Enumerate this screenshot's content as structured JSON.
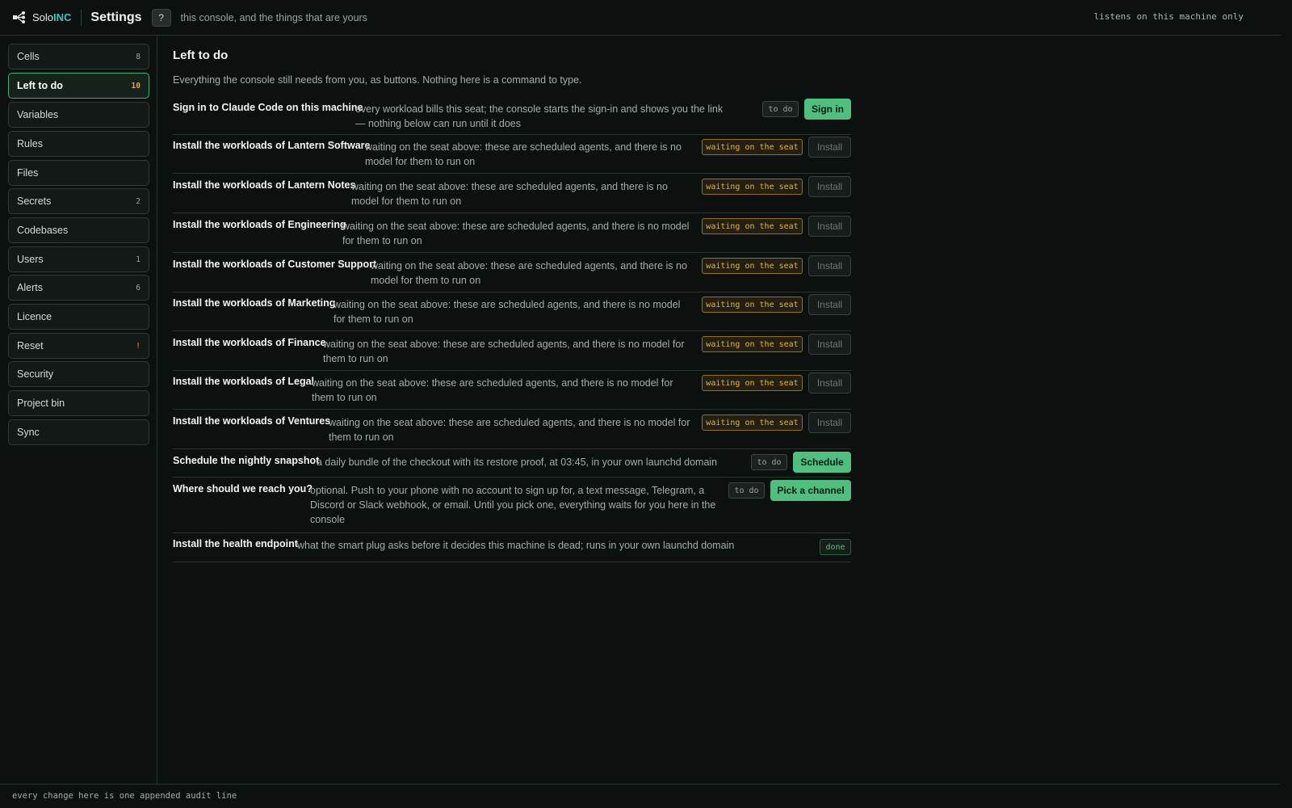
{
  "header": {
    "brand_solo": "Solo",
    "brand_inc": "INC",
    "title": "Settings",
    "help_label": "?",
    "subtitle": "this console, and the things that are yours",
    "status": "listens on this machine only"
  },
  "sidebar": {
    "items": [
      {
        "label": "Cells",
        "count": "8"
      },
      {
        "label": "Left to do",
        "count": "10"
      },
      {
        "label": "Variables",
        "count": ""
      },
      {
        "label": "Rules",
        "count": ""
      },
      {
        "label": "Files",
        "count": ""
      },
      {
        "label": "Secrets",
        "count": "2"
      },
      {
        "label": "Codebases",
        "count": ""
      },
      {
        "label": "Users",
        "count": "1"
      },
      {
        "label": "Alerts",
        "count": "6"
      },
      {
        "label": "Licence",
        "count": ""
      },
      {
        "label": "Reset",
        "count": "!"
      },
      {
        "label": "Security",
        "count": ""
      },
      {
        "label": "Project bin",
        "count": ""
      },
      {
        "label": "Sync",
        "count": ""
      }
    ]
  },
  "main": {
    "title": "Left to do",
    "lead": "Everything the console still needs from you, as buttons. Nothing here is a command to type.",
    "tasks": [
      {
        "title": "Sign in to Claude Code on this machine",
        "desc": "every workload bills this seat; the console starts the sign-in and shows you the link — nothing below can run until it does",
        "status": "to do",
        "button": "Sign in"
      },
      {
        "title": "Install the workloads of Lantern Software",
        "desc": "waiting on the seat above: these are scheduled agents, and there is no model for them to run on",
        "status": "waiting on the seat",
        "button": "Install"
      },
      {
        "title": "Install the workloads of Lantern Notes",
        "desc": "waiting on the seat above: these are scheduled agents, and there is no model for them to run on",
        "status": "waiting on the seat",
        "button": "Install"
      },
      {
        "title": "Install the workloads of Engineering",
        "desc": "waiting on the seat above: these are scheduled agents, and there is no model for them to run on",
        "status": "waiting on the seat",
        "button": "Install"
      },
      {
        "title": "Install the workloads of Customer Support",
        "desc": "waiting on the seat above: these are scheduled agents, and there is no model for them to run on",
        "status": "waiting on the seat",
        "button": "Install"
      },
      {
        "title": "Install the workloads of Marketing",
        "desc": "waiting on the seat above: these are scheduled agents, and there is no model for them to run on",
        "status": "waiting on the seat",
        "button": "Install"
      },
      {
        "title": "Install the workloads of Finance",
        "desc": "waiting on the seat above: these are scheduled agents, and there is no model for them to run on",
        "status": "waiting on the seat",
        "button": "Install"
      },
      {
        "title": "Install the workloads of Legal",
        "desc": "waiting on the seat above: these are scheduled agents, and there is no model for them to run on",
        "status": "waiting on the seat",
        "button": "Install"
      },
      {
        "title": "Install the workloads of Ventures",
        "desc": "waiting on the seat above: these are scheduled agents, and there is no model for them to run on",
        "status": "waiting on the seat",
        "button": "Install"
      },
      {
        "title": "Schedule the nightly snapshot",
        "desc": "a daily bundle of the checkout with its restore proof, at 03:45, in your own launchd domain",
        "status": "to do",
        "button": "Schedule"
      },
      {
        "title": "Where should we reach you?",
        "desc": "optional. Push to your phone with no account to sign up for, a text message, Telegram, a Discord or Slack webhook, or email. Until you pick one, everything waits for you here in the console",
        "status": "to do",
        "button": "Pick a channel"
      },
      {
        "title": "Install the health endpoint",
        "desc": "what the smart plug asks before it decides this machine is dead; runs in your own launchd domain",
        "status": "done",
        "button": ""
      }
    ]
  },
  "footer": {
    "text": "every change here is one appended audit line"
  }
}
